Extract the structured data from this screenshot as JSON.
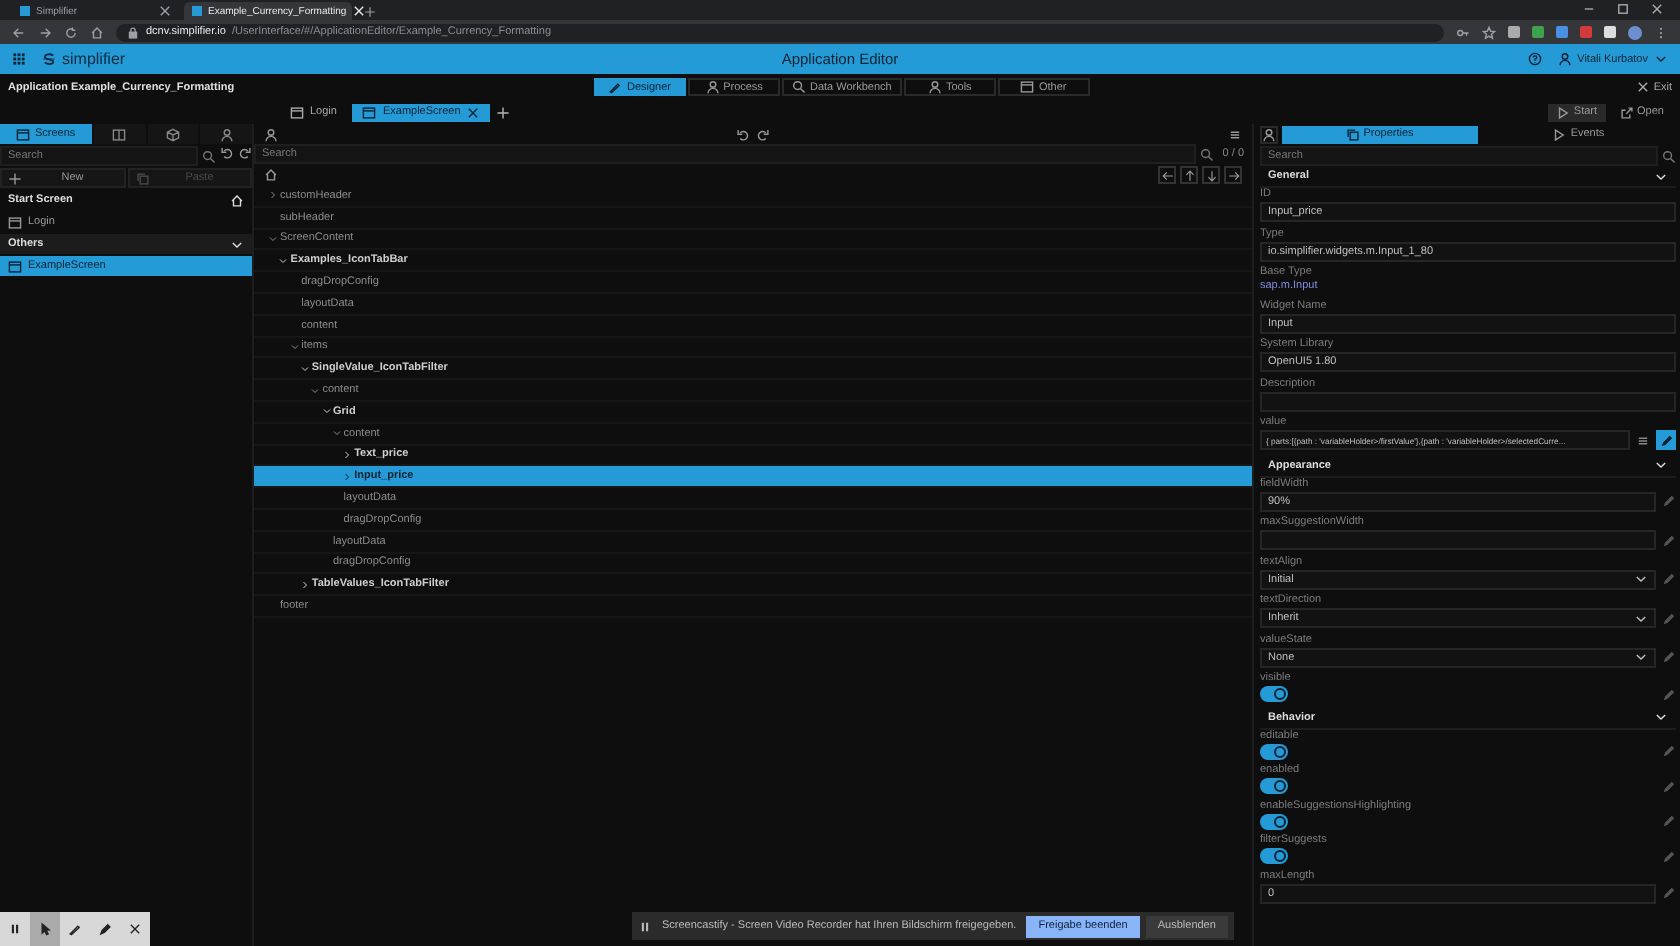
{
  "browser": {
    "tabs": [
      {
        "title": "Simplifier",
        "selected": false
      },
      {
        "title": "Example_Currency_Formatting",
        "selected": true
      }
    ],
    "url_host": "dcnv.simplifier.io",
    "url_path": "/UserInterface/#/ApplicationEditor/Example_Currency_Formatting"
  },
  "app_bar": {
    "logo": "simplifier",
    "title": "Application Editor",
    "user": "Vitali Kurbatov"
  },
  "toolbar": {
    "application": "Application Example_Currency_Formatting",
    "modes": [
      {
        "label": "Designer",
        "selected": true
      },
      {
        "label": "Process",
        "selected": false
      },
      {
        "label": "Data Workbench",
        "selected": false
      },
      {
        "label": "Tools",
        "selected": false
      },
      {
        "label": "Other",
        "selected": false
      }
    ],
    "exit": "Exit"
  },
  "screen_tabs": {
    "tabs": [
      {
        "label": "Login",
        "selected": false
      },
      {
        "label": "ExampleScreen",
        "selected": true
      }
    ],
    "actions": [
      "Start",
      "Open"
    ]
  },
  "screens_panel": {
    "tabs": [
      {
        "label": "Screens",
        "selected": true
      },
      {
        "selected": false
      },
      {
        "selected": false
      },
      {
        "selected": false
      }
    ],
    "search": {
      "placeholder": "Search"
    },
    "new": "New",
    "paste": {
      "label": "Paste",
      "disabled": true
    },
    "groups": [
      {
        "kind": "start",
        "title": "Start Screen",
        "items": [
          {
            "label": "Login",
            "selected": false
          }
        ]
      },
      {
        "kind": "group",
        "title": "Others",
        "expanded": true,
        "items": [
          {
            "label": "ExampleScreen",
            "selected": true
          }
        ]
      }
    ]
  },
  "tree": {
    "search": {
      "placeholder": "Search"
    },
    "count": "0 / 0",
    "nodes": [
      {
        "label": "customHeader",
        "kind": "property",
        "expanded": false,
        "selected": false
      },
      {
        "label": "subHeader",
        "kind": "property",
        "selected": false
      },
      {
        "label": "ScreenContent",
        "kind": "property",
        "expanded": true,
        "selected": false,
        "children": [
          {
            "label": "Examples_IconTabBar",
            "kind": "widget",
            "expanded": true,
            "selected": false,
            "children": [
              {
                "label": "dragDropConfig",
                "kind": "property",
                "selected": false
              },
              {
                "label": "layoutData",
                "kind": "property",
                "selected": false
              },
              {
                "label": "content",
                "kind": "property",
                "selected": false
              },
              {
                "label": "items",
                "kind": "property",
                "expanded": true,
                "selected": false,
                "children": [
                  {
                    "label": "SingleValue_IconTabFilter",
                    "kind": "widget",
                    "expanded": true,
                    "selected": false,
                    "children": [
                      {
                        "label": "content",
                        "kind": "property",
                        "expanded": true,
                        "selected": false,
                        "children": [
                          {
                            "label": "Grid",
                            "kind": "widget",
                            "expanded": true,
                            "selected": false,
                            "children": [
                              {
                                "label": "content",
                                "kind": "property",
                                "expanded": true,
                                "selected": false,
                                "children": [
                                  {
                                    "label": "Text_price",
                                    "kind": "widget",
                                    "expanded": false,
                                    "selected": false
                                  },
                                  {
                                    "label": "Input_price",
                                    "kind": "widget",
                                    "expanded": false,
                                    "selected": true
                                  }
                                ]
                              },
                              {
                                "label": "layoutData",
                                "kind": "property",
                                "selected": false
                              },
                              {
                                "label": "dragDropConfig",
                                "kind": "property",
                                "selected": false
                              }
                            ]
                          },
                          {
                            "label": "layoutData",
                            "kind": "property",
                            "selected": false
                          },
                          {
                            "label": "dragDropConfig",
                            "kind": "property",
                            "selected": false
                          }
                        ]
                      }
                    ]
                  },
                  {
                    "label": "TableValues_IconTabFilter",
                    "kind": "widget",
                    "expanded": false,
                    "selected": false
                  }
                ]
              }
            ]
          }
        ]
      },
      {
        "label": "footer",
        "kind": "property",
        "selected": false
      }
    ]
  },
  "properties": {
    "tabs": [
      {
        "label": "Properties",
        "selected": true
      },
      {
        "label": "Events",
        "selected": false
      }
    ],
    "search": {
      "placeholder": "Search"
    },
    "sections": [
      {
        "title": "General",
        "expanded": true,
        "editable": false,
        "fields": [
          {
            "kind": "text",
            "label": "ID",
            "value": "Input_price"
          },
          {
            "kind": "text",
            "label": "Type",
            "value": "io.simplifier.widgets.m.Input_1_80"
          },
          {
            "kind": "static",
            "label": "Base Type",
            "value": "sap.m.Input"
          },
          {
            "kind": "text",
            "label": "Widget Name",
            "value": "Input"
          },
          {
            "kind": "text",
            "label": "System Library",
            "value": "OpenUI5 1.80"
          },
          {
            "kind": "text",
            "label": "Description"
          },
          {
            "kind": "binding",
            "label": "value",
            "value": "{ parts:[{path : 'variableHolder>/firstValue'},{path : 'variableHolder>/selectedCurre..."
          }
        ]
      },
      {
        "title": "Appearance",
        "expanded": true,
        "editable": true,
        "fields": [
          {
            "kind": "text",
            "label": "fieldWidth",
            "value": "90%"
          },
          {
            "kind": "text",
            "label": "maxSuggestionWidth"
          },
          {
            "kind": "select",
            "label": "textAlign",
            "value": "Initial"
          },
          {
            "kind": "select",
            "label": "textDirection",
            "value": "Inherit"
          },
          {
            "kind": "select",
            "label": "valueState",
            "value": "None"
          },
          {
            "kind": "toggle",
            "label": "visible",
            "on": true
          }
        ]
      },
      {
        "title": "Behavior",
        "expanded": true,
        "editable": true,
        "fields": [
          {
            "kind": "toggle",
            "label": "editable",
            "on": true
          },
          {
            "kind": "toggle",
            "label": "enabled",
            "on": true
          },
          {
            "kind": "toggle",
            "label": "enableSuggestionsHighlighting",
            "on": true
          },
          {
            "kind": "toggle",
            "label": "filterSuggests",
            "on": true
          },
          {
            "kind": "text",
            "label": "maxLength",
            "value": "0"
          }
        ]
      }
    ]
  },
  "recorder": {
    "tools": [
      {
        "selected": false
      },
      {
        "selected": true
      },
      {
        "selected": false
      },
      {
        "selected": false
      },
      {
        "selected": false
      }
    ]
  },
  "notification": {
    "text": "Screencastify - Screen Video Recorder hat Ihren Bildschirm freigegeben.",
    "buttons": [
      {
        "label": "Freigabe beenden",
        "primary": true
      },
      {
        "label": "Ausblenden",
        "primary": false
      }
    ]
  }
}
